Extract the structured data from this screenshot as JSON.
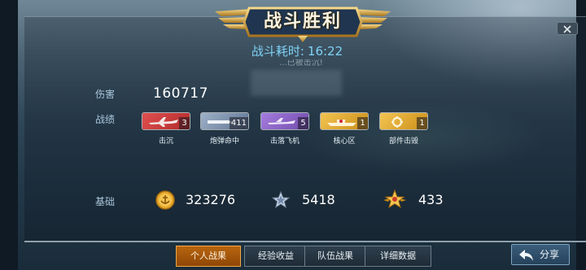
{
  "banner": {
    "title": "战斗胜利"
  },
  "battle_time": {
    "label": "战斗耗时:",
    "value": "16:22"
  },
  "sunk_note": "...已被击沉!",
  "damage": {
    "label": "伤害",
    "value": "160717"
  },
  "record": {
    "label": "战绩",
    "medals": [
      {
        "label": "击沉",
        "count": "3",
        "icon": "plane-icon",
        "color": "#c83a3a"
      },
      {
        "label": "炮弹命中",
        "count": "411",
        "icon": "shell-icon",
        "color": "#6f8aa8"
      },
      {
        "label": "击落飞机",
        "count": "5",
        "icon": "aircraft-icon",
        "color": "#8a5ec2"
      },
      {
        "label": "核心区",
        "count": "1",
        "icon": "ship-core-icon",
        "color": "#e0a82a"
      },
      {
        "label": "部件击毁",
        "count": "1",
        "icon": "gear-icon",
        "color": "#e0a82a"
      }
    ]
  },
  "base": {
    "label": "基础",
    "resources": [
      {
        "icon": "gold-coin-anchor-icon",
        "value": "323276"
      },
      {
        "icon": "silver-star-icon",
        "value": "5418"
      },
      {
        "icon": "gold-star-icon",
        "value": "433"
      }
    ]
  },
  "tabs": [
    "个人战果",
    "经验收益",
    "队伍战果",
    "详细数据"
  ],
  "active_tab": 0,
  "share": {
    "label": "分享"
  },
  "colors": {
    "accent": "#7fd2f5",
    "tab_active": "#b8650e",
    "banner_gold": "#e2b24a"
  }
}
